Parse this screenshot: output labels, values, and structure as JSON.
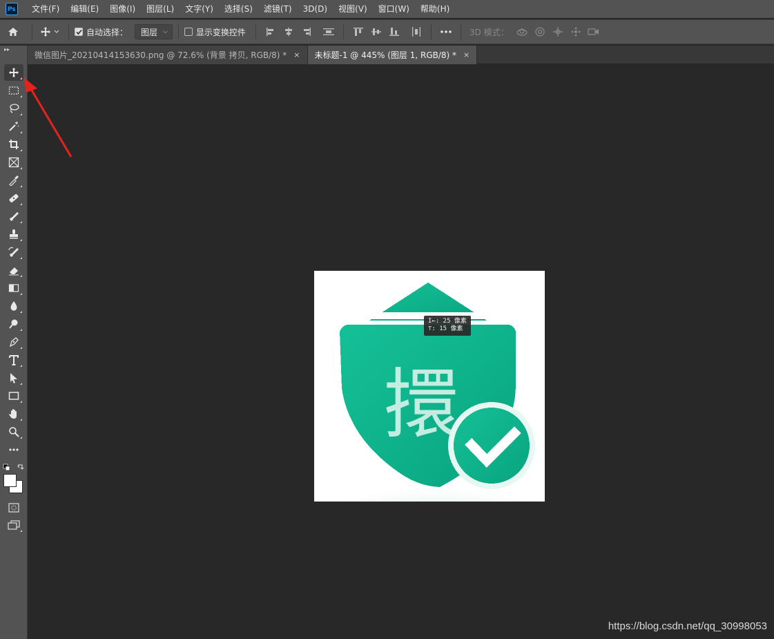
{
  "app": {
    "logo_text": "Ps"
  },
  "menu": {
    "items": [
      "文件(F)",
      "编辑(E)",
      "图像(I)",
      "图层(L)",
      "文字(Y)",
      "选择(S)",
      "滤镜(T)",
      "3D(D)",
      "视图(V)",
      "窗口(W)",
      "帮助(H)"
    ]
  },
  "options": {
    "auto_select_label": "自动选择：",
    "auto_select_checked": true,
    "auto_select_value": "图层",
    "show_transform_label": "显示变换控件",
    "show_transform_checked": false,
    "mode_3d_label": "3D 模式："
  },
  "tabs": [
    {
      "label": "微信图片_20210414153630.png @ 72.6% (背景 拷贝, RGB/8) *",
      "active": false
    },
    {
      "label": "未标题-1 @ 445% (图层 1, RGB/8) *",
      "active": true
    }
  ],
  "tab_close_glyph": "×",
  "tooltip": {
    "line1": "I←: 25 像素",
    "line2": "⊤: 15 像素"
  },
  "canvas_image": {
    "glyph": "擐",
    "accent": "#10b48c"
  },
  "watermark": "https://blog.csdn.net/qq_30998053",
  "colors": {
    "panel": "#535353",
    "workspace": "#282828",
    "highlight_arrow": "#e3241c"
  },
  "tools": [
    "move-icon",
    "marquee-icon",
    "lasso-icon",
    "magic-wand-icon",
    "crop-icon",
    "frame-icon",
    "eyedropper-icon",
    "healing-brush-icon",
    "brush-icon",
    "stamp-icon",
    "history-brush-icon",
    "eraser-icon",
    "gradient-icon",
    "blur-icon",
    "dodge-icon",
    "pen-icon",
    "type-icon",
    "path-select-icon",
    "rectangle-icon",
    "hand-icon",
    "zoom-icon",
    "more-tools-icon"
  ]
}
